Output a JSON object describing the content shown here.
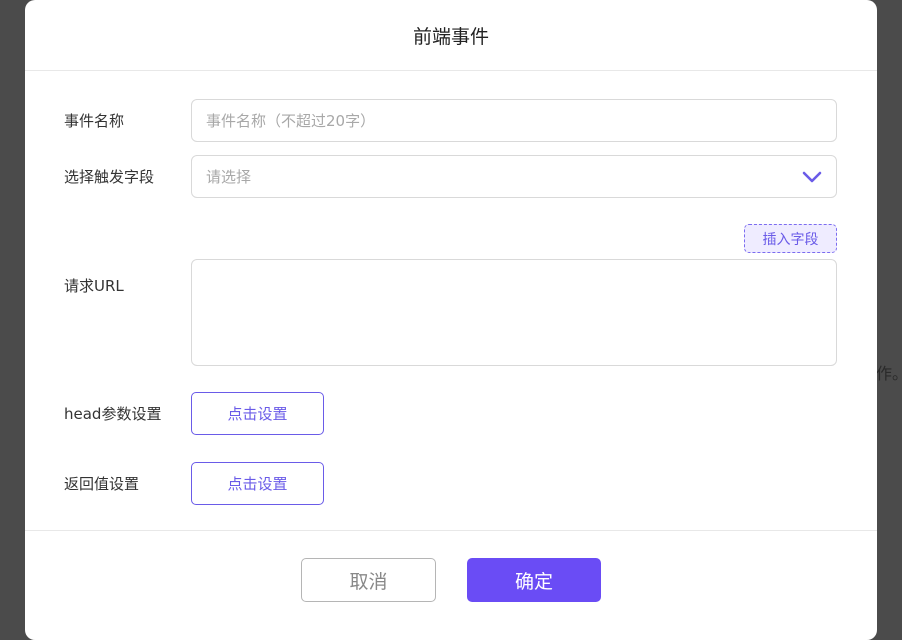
{
  "background": {
    "partial_text": "作。"
  },
  "modal": {
    "title": "前端事件",
    "fields": {
      "event_name": {
        "label": "事件名称",
        "placeholder": "事件名称（不超过20字）",
        "value": ""
      },
      "trigger_field": {
        "label": "选择触发字段",
        "placeholder": "请选择"
      },
      "request_url": {
        "label": "请求URL",
        "insert_button": "插入字段",
        "value": ""
      },
      "head_params": {
        "label": "head参数设置",
        "button": "点击设置"
      },
      "return_value": {
        "label": "返回值设置",
        "button": "点击设置"
      }
    },
    "footer": {
      "cancel": "取消",
      "confirm": "确定"
    }
  },
  "colors": {
    "accent": "#6a4cf5",
    "accent_text": "#6a5be8",
    "overlay": "#4b4b4b"
  },
  "icons": {
    "select_arrow": "chevron-down-icon"
  }
}
